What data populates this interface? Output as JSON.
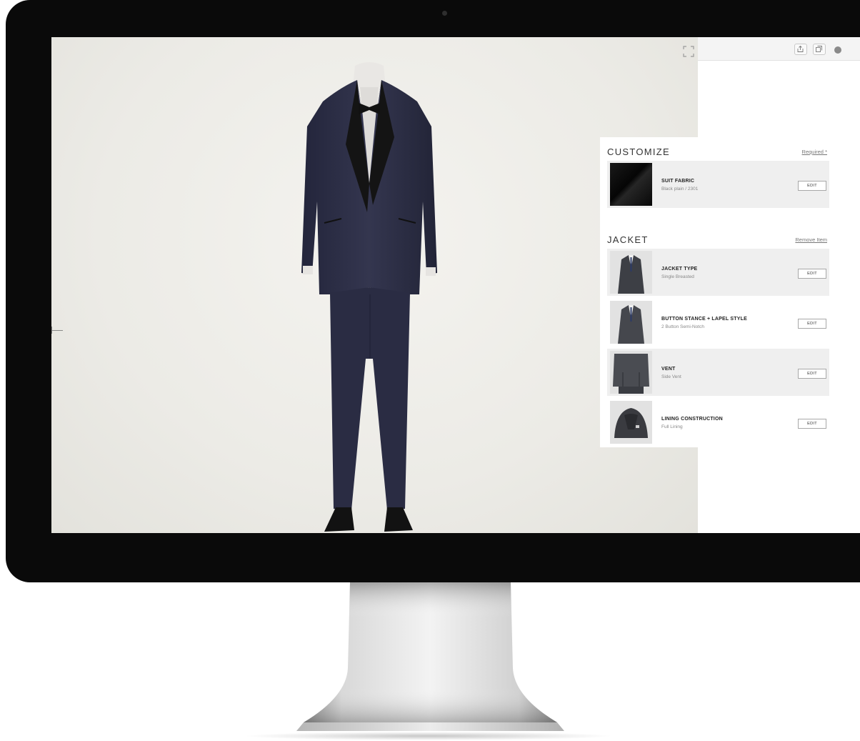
{
  "customize": {
    "title": "CUSTOMIZE",
    "link": "Required *",
    "fabric": {
      "label": "SUIT FABRIC",
      "value": "Black plain / 2301",
      "edit": "EDIT"
    }
  },
  "jacket": {
    "title": "JACKET",
    "link": "Remove Item",
    "items": [
      {
        "label": "JACKET TYPE",
        "value": "Single Breasted",
        "edit": "EDIT"
      },
      {
        "label": "BUTTON STANCE + LAPEL STYLE",
        "value": "2 Button Semi-Notch",
        "edit": "EDIT"
      },
      {
        "label": "VENT",
        "value": "Side Vent",
        "edit": "EDIT"
      },
      {
        "label": "LINING CONSTRUCTION",
        "value": "Full Lining",
        "edit": "EDIT"
      }
    ]
  },
  "icons": {
    "expand": "expand-icon",
    "share": "share-icon",
    "tabs": "tabs-icon"
  },
  "colors": {
    "suit": "#2b2d45",
    "lapel": "#151515",
    "row_shade": "#efefef"
  }
}
